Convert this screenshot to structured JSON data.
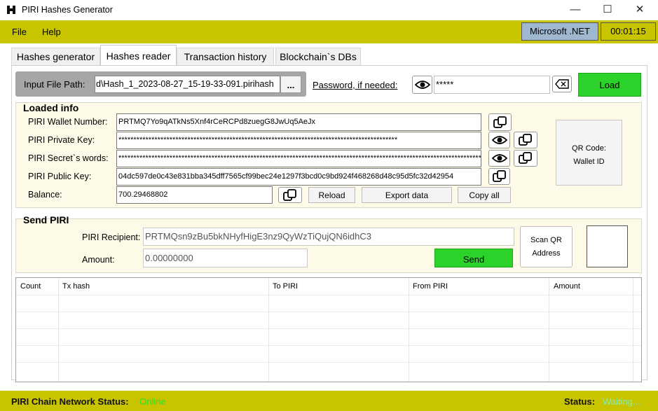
{
  "window": {
    "title": "PIRI Hashes Generator",
    "minimize": "—",
    "maximize": "☐",
    "close": "✕"
  },
  "menu": {
    "file": "File",
    "help": "Help",
    "runtime": "Microsoft .NET",
    "timer": "00:01:15"
  },
  "tabs": [
    {
      "label": "Hashes generator"
    },
    {
      "label": "Hashes reader"
    },
    {
      "label": "Transaction history"
    },
    {
      "label": "Blockchain`s DBs"
    }
  ],
  "file": {
    "label": "Input File Path:",
    "value": "d\\Hash_1_2023-08-27_15-19-33-091.pirihash",
    "browse": "..."
  },
  "password": {
    "label": "Password, if needed:",
    "value": "*****",
    "load": "Load"
  },
  "loaded": {
    "title": "Loaded info",
    "wallet_label": "PIRI Wallet Number:",
    "wallet_value": "PRTMQ7Yo9qATkNs5Xnf4rCeRCPd8zuegG8JwUq5AeJx",
    "private_label": "PIRI Private Key:",
    "private_value": "*********************************************************************************************",
    "secret_label": "PIRI Secret`s words:",
    "secret_value": "************************************************************************************************************************************************************",
    "public_label": "PIRI Public Key:",
    "public_value": "04dc597de0c43e831bba345dff7565cf99bec24e1297f3bcd0c9bd924f468268d48c95d5fc32d42954",
    "balance_label": "Balance:",
    "balance_value": "700.29468802",
    "reload": "Reload",
    "export": "Export data",
    "copy_all": "Copy all",
    "qr_line1": "QR Code:",
    "qr_line2": "Wallet ID"
  },
  "send": {
    "title": "Send PIRI",
    "recipient_label": "PIRI Recipient:",
    "recipient_value": "PRTMQsn9zBu5bkNHyfHigE3nz9QyWzTiQujQN6idhC3",
    "amount_label": "Amount:",
    "amount_value": "0.00000000",
    "send": "Send",
    "scan_line1": "Scan QR",
    "scan_line2": "Address"
  },
  "table": {
    "columns": [
      "Count",
      "Tx hash",
      "To PIRI",
      "From PIRI",
      "Amount"
    ]
  },
  "status": {
    "network_label": "PIRI Chain Network Status:",
    "network_value": "Online",
    "status_label": "Status:",
    "status_value": "Waiting...",
    "colors": {
      "bar": "#c8c400",
      "online": "#2ee02e",
      "waiting": "#7ef0c0",
      "button": "#2ad22a"
    }
  }
}
